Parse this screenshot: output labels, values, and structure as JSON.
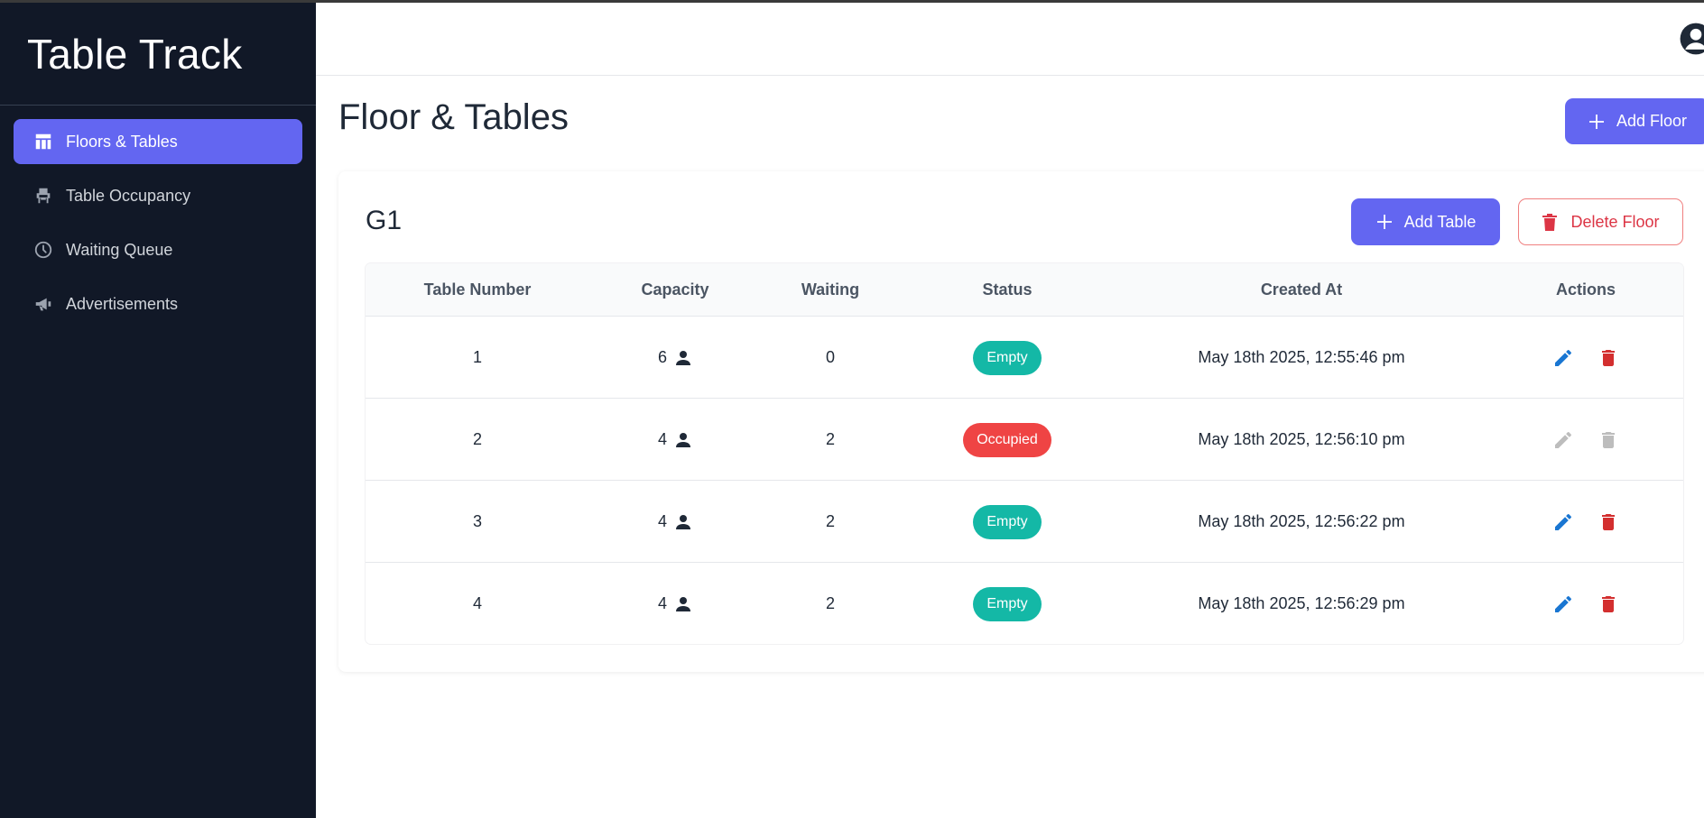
{
  "app": {
    "title": "Table Track"
  },
  "sidebar": {
    "items": [
      {
        "label": "Floors & Tables",
        "icon": "table-layout-icon",
        "active": true
      },
      {
        "label": "Table Occupancy",
        "icon": "chair-icon",
        "active": false
      },
      {
        "label": "Waiting Queue",
        "icon": "clock-icon",
        "active": false
      },
      {
        "label": "Advertisements",
        "icon": "megaphone-icon",
        "active": false
      }
    ]
  },
  "header": {
    "user_icon": "user-circle-icon"
  },
  "main": {
    "title": "Floor & Tables",
    "add_floor_label": "Add Floor"
  },
  "floor": {
    "name": "G1",
    "add_table_label": "Add Table",
    "delete_floor_label": "Delete Floor",
    "columns": [
      "Table Number",
      "Capacity",
      "Waiting",
      "Status",
      "Created At",
      "Actions"
    ],
    "rows": [
      {
        "number": "1",
        "capacity": "6",
        "waiting": "0",
        "status": "Empty",
        "created_at": "May 18th 2025, 12:55:46 pm",
        "actions_enabled": true
      },
      {
        "number": "2",
        "capacity": "4",
        "waiting": "2",
        "status": "Occupied",
        "created_at": "May 18th 2025, 12:56:10 pm",
        "actions_enabled": false
      },
      {
        "number": "3",
        "capacity": "4",
        "waiting": "2",
        "status": "Empty",
        "created_at": "May 18th 2025, 12:56:22 pm",
        "actions_enabled": true
      },
      {
        "number": "4",
        "capacity": "4",
        "waiting": "2",
        "status": "Empty",
        "created_at": "May 18th 2025, 12:56:29 pm",
        "actions_enabled": true
      }
    ]
  },
  "colors": {
    "sidebar_bg": "#111827",
    "accent": "#6366f1",
    "empty_status": "#14b8a6",
    "occupied_status": "#ef4444",
    "edit_icon": "#1976d2",
    "delete_icon": "#d32f2f",
    "disabled_icon": "#bdbdbd"
  }
}
